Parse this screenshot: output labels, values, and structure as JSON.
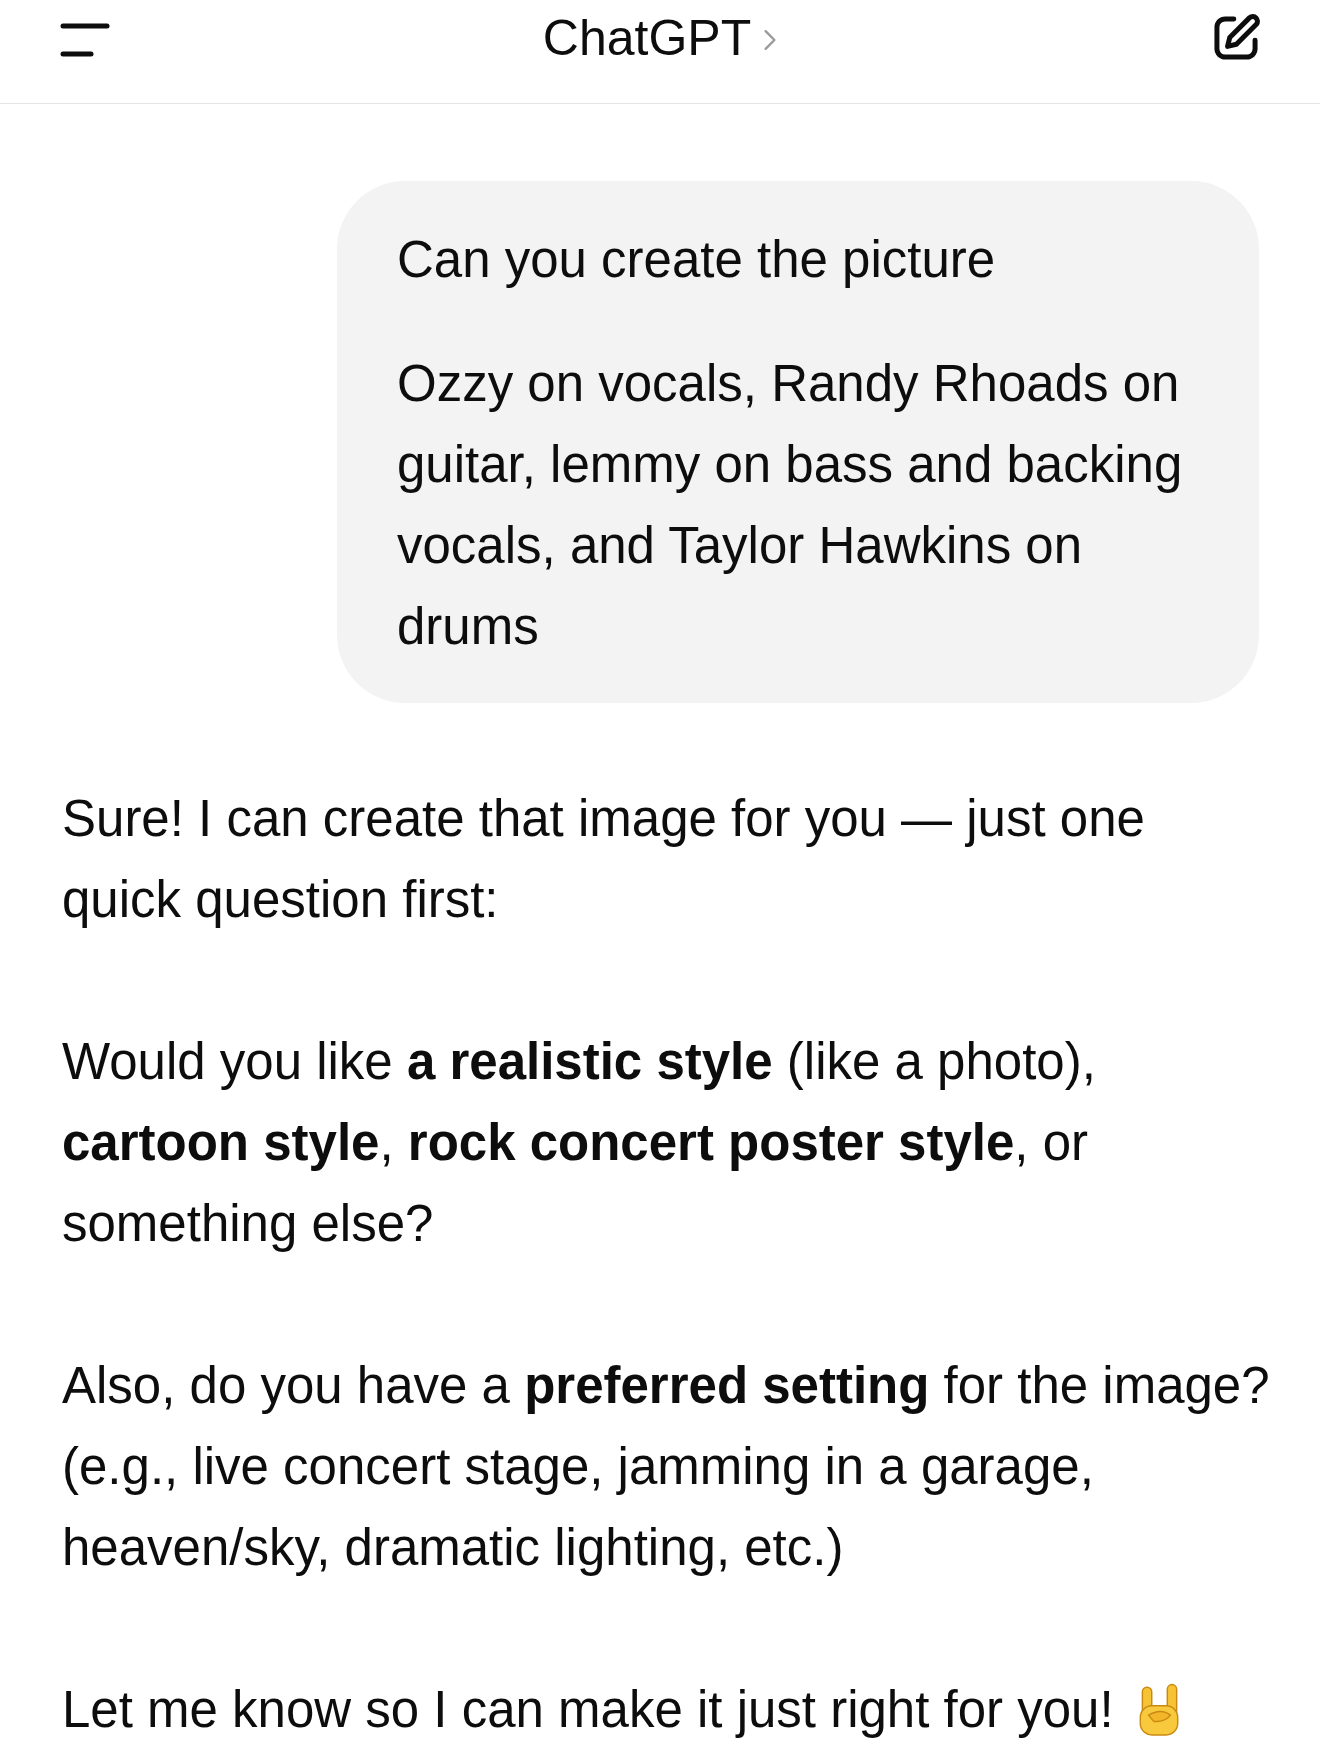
{
  "header": {
    "title": "ChatGPT"
  },
  "messages": [
    {
      "kind": "user",
      "paragraphs": [
        "Can you create the picture",
        "Ozzy on vocals, Randy Rhoads on guitar, lemmy on bass and backing vocals, and Taylor Hawkins on drums"
      ]
    },
    {
      "kind": "assistant",
      "paragraphs": [
        "Sure! I can create that image for you — just one quick question first:",
        "Would you like **a realistic style** (like a photo), **cartoon style**, **rock concert poster style**, or something else?",
        "Also, do you have a **preferred setting** for the image? (e.g., live concert stage, jamming in a garage, heaven/sky, dramatic lighting, etc.)",
        "Let me know so I can make it just right for you!"
      ]
    }
  ]
}
